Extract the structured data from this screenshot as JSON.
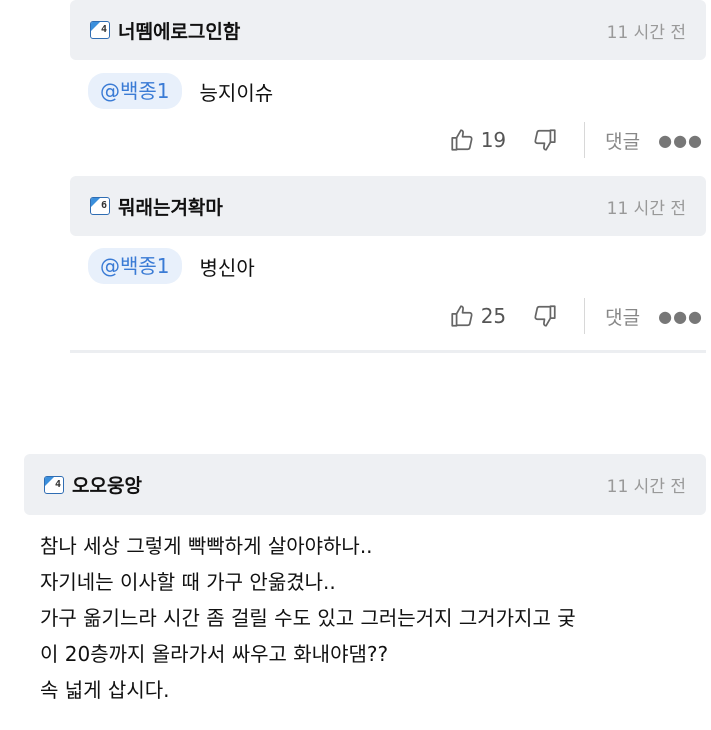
{
  "replies": [
    {
      "level": "4",
      "nickname": "너뗌에로그인함",
      "time": "11 시간 전",
      "mention": "@백종1",
      "text": "능지이슈",
      "likes": "19",
      "reply_label": "댓글"
    },
    {
      "level": "6",
      "nickname": "뭐래는겨확마",
      "time": "11 시간 전",
      "mention": "@백종1",
      "text": "병신아",
      "likes": "25",
      "reply_label": "댓글"
    }
  ],
  "post": {
    "level": "4",
    "nickname": "오오웅앙",
    "time": "11 시간 전",
    "lines": [
      "참나 세상 그렇게 빡빡하게 살아야하나..",
      "자기네는 이사할 때 가구 안옮겼나..",
      "가구 옮기느라 시간 좀 걸릴 수도 있고 그러는거지 그거가지고 궂",
      "이 20층까지 올라가서 싸우고 화내야댐??",
      "속 넓게 삽시다."
    ]
  },
  "icons": {
    "like": "thumbs-up-icon",
    "dislike": "thumbs-down-icon",
    "more": "more-dots-icon",
    "level_badge": "level-badge-icon"
  },
  "colors": {
    "mention_text": "#3a7bd5",
    "mention_bg": "#e8f0fb",
    "header_bg": "#eef0f3",
    "level_blue": "#3b8fdc",
    "muted": "#999999"
  }
}
